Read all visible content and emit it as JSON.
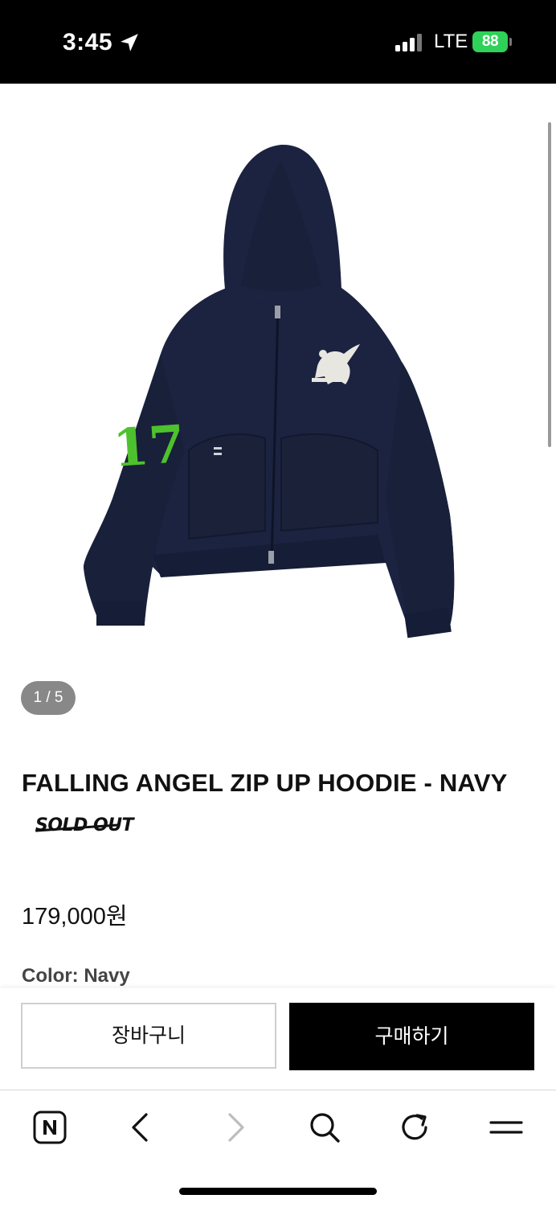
{
  "status_bar": {
    "time": "3:45",
    "network": "LTE",
    "battery": "88"
  },
  "product": {
    "image_counter": "1 / 5",
    "title": "FALLING ANGEL ZIP UP HOODIE - NAVY",
    "sold_out_label": "SOLD OUT",
    "price": "179,000원",
    "color_label": "Color: Navy",
    "hoodie_color": "#1c2340",
    "number_patch_color": "#4ec12e",
    "number_patch_text": "17"
  },
  "actions": {
    "cart_label": "장바구니",
    "buy_label": "구매하기"
  },
  "browser_toolbar": {
    "icons": [
      "naver-home-icon",
      "back-icon",
      "forward-icon",
      "search-icon",
      "reload-icon",
      "menu-icon"
    ]
  }
}
